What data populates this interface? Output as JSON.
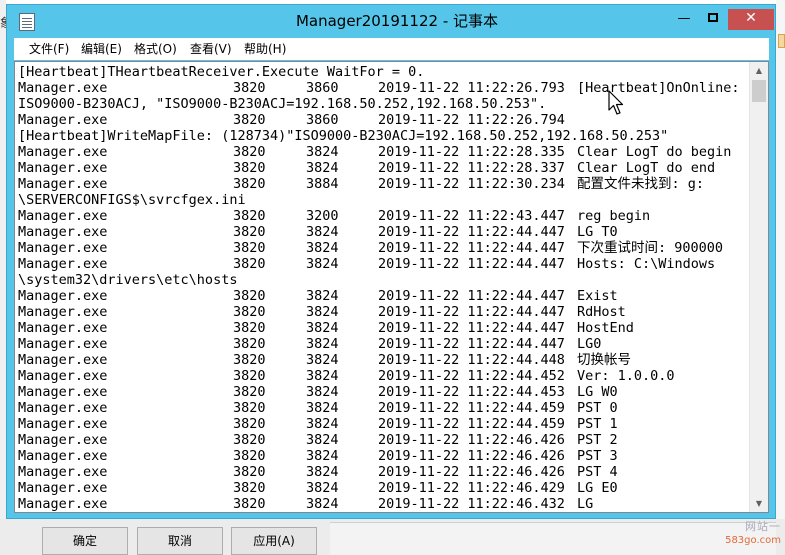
{
  "window": {
    "title": "Manager20191122 - 记事本",
    "icon": "notepad-icon",
    "controls": {
      "minimize": "—",
      "close": "✕"
    }
  },
  "menu": [
    {
      "label": "文件(F)"
    },
    {
      "label": "编辑(E)"
    },
    {
      "label": "格式(O)"
    },
    {
      "label": "查看(V)"
    },
    {
      "label": "帮助(H)"
    }
  ],
  "lines": [
    {
      "text": "[Heartbeat]THeartbeatReceiver.Execute WaitFor = 0."
    },
    {
      "proc": "Manager.exe",
      "pid": "3820",
      "tid": "3860",
      "time": "2019-11-22 11:22:26.793",
      "msg": "[Heartbeat]OnOnline:"
    },
    {
      "text": "ISO9000-B230ACJ, \"ISO9000-B230ACJ=192.168.50.252,192.168.50.253\"."
    },
    {
      "proc": "Manager.exe",
      "pid": "3820",
      "tid": "3860",
      "time": "2019-11-22 11:22:26.794",
      "msg": ""
    },
    {
      "text": "[Heartbeat]WriteMapFile: (128734)\"ISO9000-B230ACJ=192.168.50.252,192.168.50.253\""
    },
    {
      "proc": "Manager.exe",
      "pid": "3820",
      "tid": "3824",
      "time": "2019-11-22 11:22:28.335",
      "msg": "Clear LogT do begin"
    },
    {
      "proc": "Manager.exe",
      "pid": "3820",
      "tid": "3824",
      "time": "2019-11-22 11:22:28.337",
      "msg": "Clear LogT do end"
    },
    {
      "proc": "Manager.exe",
      "pid": "3820",
      "tid": "3884",
      "time": "2019-11-22 11:22:30.234",
      "msg": "配置文件未找到: g:"
    },
    {
      "text": "\\SERVERCONFIGS$\\svrcfgex.ini"
    },
    {
      "proc": "Manager.exe",
      "pid": "3820",
      "tid": "3200",
      "time": "2019-11-22 11:22:43.447",
      "msg": "reg begin"
    },
    {
      "proc": "Manager.exe",
      "pid": "3820",
      "tid": "3824",
      "time": "2019-11-22 11:22:44.447",
      "msg": "LG T0"
    },
    {
      "proc": "Manager.exe",
      "pid": "3820",
      "tid": "3824",
      "time": "2019-11-22 11:22:44.447",
      "msg": "下次重试时间: 900000"
    },
    {
      "proc": "Manager.exe",
      "pid": "3820",
      "tid": "3824",
      "time": "2019-11-22 11:22:44.447",
      "msg": "Hosts: C:\\Windows"
    },
    {
      "text": "\\system32\\drivers\\etc\\hosts"
    },
    {
      "proc": "Manager.exe",
      "pid": "3820",
      "tid": "3824",
      "time": "2019-11-22 11:22:44.447",
      "msg": "Exist"
    },
    {
      "proc": "Manager.exe",
      "pid": "3820",
      "tid": "3824",
      "time": "2019-11-22 11:22:44.447",
      "msg": "RdHost"
    },
    {
      "proc": "Manager.exe",
      "pid": "3820",
      "tid": "3824",
      "time": "2019-11-22 11:22:44.447",
      "msg": "HostEnd"
    },
    {
      "proc": "Manager.exe",
      "pid": "3820",
      "tid": "3824",
      "time": "2019-11-22 11:22:44.447",
      "msg": "LG0"
    },
    {
      "proc": "Manager.exe",
      "pid": "3820",
      "tid": "3824",
      "time": "2019-11-22 11:22:44.448",
      "msg": "切换帐号"
    },
    {
      "proc": "Manager.exe",
      "pid": "3820",
      "tid": "3824",
      "time": "2019-11-22 11:22:44.452",
      "msg": "Ver: 1.0.0.0"
    },
    {
      "proc": "Manager.exe",
      "pid": "3820",
      "tid": "3824",
      "time": "2019-11-22 11:22:44.453",
      "msg": "LG W0"
    },
    {
      "proc": "Manager.exe",
      "pid": "3820",
      "tid": "3824",
      "time": "2019-11-22 11:22:44.459",
      "msg": "PST 0"
    },
    {
      "proc": "Manager.exe",
      "pid": "3820",
      "tid": "3824",
      "time": "2019-11-22 11:22:44.459",
      "msg": "PST 1"
    },
    {
      "proc": "Manager.exe",
      "pid": "3820",
      "tid": "3824",
      "time": "2019-11-22 11:22:46.426",
      "msg": "PST 2"
    },
    {
      "proc": "Manager.exe",
      "pid": "3820",
      "tid": "3824",
      "time": "2019-11-22 11:22:46.426",
      "msg": "PST 3"
    },
    {
      "proc": "Manager.exe",
      "pid": "3820",
      "tid": "3824",
      "time": "2019-11-22 11:22:46.426",
      "msg": "PST 4"
    },
    {
      "proc": "Manager.exe",
      "pid": "3820",
      "tid": "3824",
      "time": "2019-11-22 11:22:46.429",
      "msg": "LG E0"
    },
    {
      "proc": "Manager.exe",
      "pid": "3820",
      "tid": "3824",
      "time": "2019-11-22 11:22:46.432",
      "msg": "LG"
    }
  ],
  "background": {
    "left_char": "象",
    "buttons": [
      {
        "label": "确定"
      },
      {
        "label": "取消"
      },
      {
        "label": "应用(A)"
      }
    ],
    "watermark_top": "网站一",
    "watermark": "583go.com"
  },
  "colors": {
    "titlebar": "#55c6ea",
    "close_button": "#c75050"
  }
}
